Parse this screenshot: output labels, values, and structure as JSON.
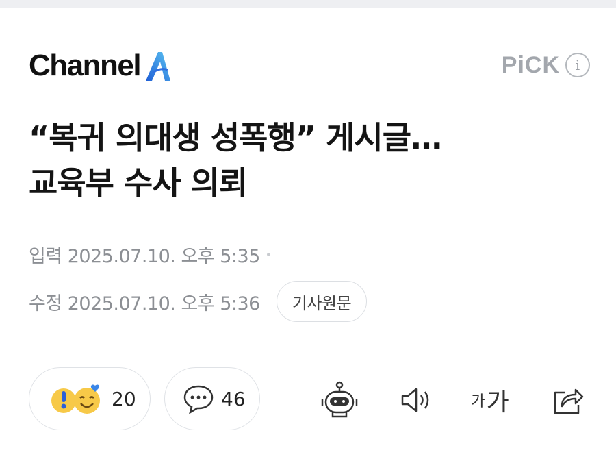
{
  "brand": {
    "logo_text": "Channel",
    "logo_mark": "A",
    "pick_label": "PiCK",
    "info_icon": "i"
  },
  "article": {
    "headline_line1": "“복귀 의대생 성폭행” 게시글…",
    "headline_line2": "교육부 수사 의뢰"
  },
  "meta": {
    "input_label": "입력",
    "input_time": "2025.07.10. 오후 5:35",
    "edit_label": "수정",
    "edit_time": "2025.07.10. 오후 5:36",
    "original_button": "기사원문"
  },
  "actions": {
    "reaction_count": "20",
    "comment_count": "46",
    "font_small": "가",
    "font_big": "가",
    "icons": [
      "reaction-emoji-icon",
      "comment-bubble-icon",
      "robot-summary-icon",
      "speaker-icon",
      "font-size-icon",
      "share-icon"
    ]
  },
  "colors": {
    "logo_blue": "#2f6fe0",
    "logo_sky": "#4fb8f0",
    "pick_gray": "#a3a7ad",
    "meta_gray": "#8c8f94",
    "emoji_yellow": "#f7c948"
  }
}
